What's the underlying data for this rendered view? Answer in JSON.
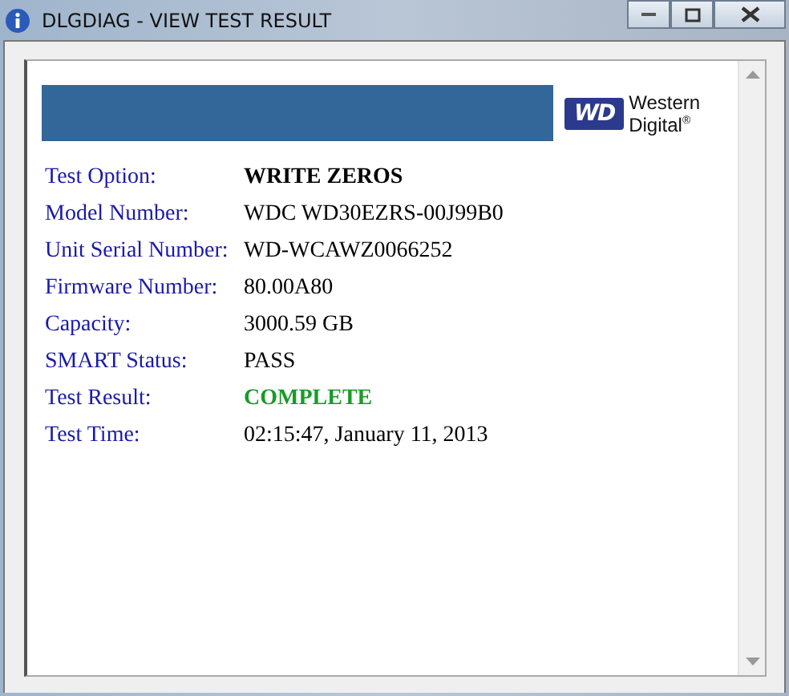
{
  "window": {
    "title": "DLGDIAG - VIEW TEST RESULT"
  },
  "logo": {
    "mark": "WD",
    "line_1": "Western",
    "line_2": "Digital$^{®}$"
  },
  "results": [
    {
      "label": "Test Option:",
      "value": "WRITE ZEROS",
      "kind": "bold"
    },
    {
      "label": "Model Number:",
      "value": "WDC WD30EZRS-00J99B0",
      "kind": "plain"
    },
    {
      "label": "Unit Serial Number:",
      "value": "WD-WCAWZ0066252",
      "kind": "plain"
    },
    {
      "label": "Firmware Number:",
      "value": "80.00A80",
      "kind": "plain"
    },
    {
      "label": "Capacity:",
      "value": "3000.59 GB",
      "kind": "plain"
    },
    {
      "label": "SMART Status:",
      "value": "PASS",
      "kind": "plain"
    },
    {
      "label": "Test Result:",
      "value": "COMPLETE",
      "kind": "success"
    },
    {
      "label": "Test Time:",
      "value": "02:15:47, January 11, 2013",
      "kind": "plain"
    }
  ]
}
